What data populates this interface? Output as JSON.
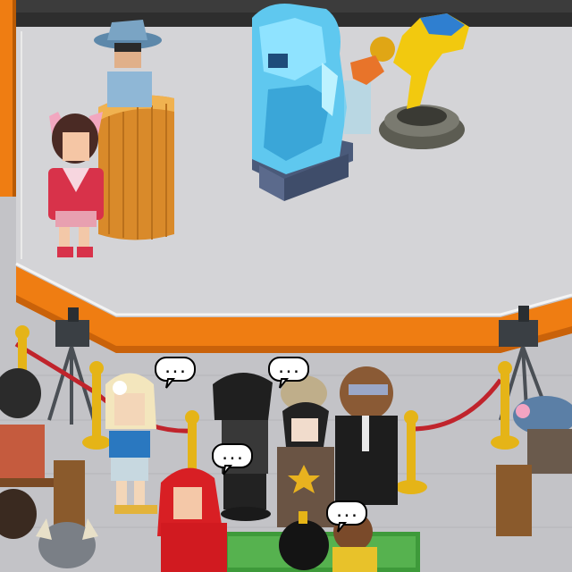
{
  "room": {
    "floor_color": "#c9c9cd",
    "stage_color": "#d3d3d6",
    "trim_color": "#ef7d12",
    "wall_color": "#2b2b2b"
  },
  "speech_bubbles": [
    {
      "text": "..."
    },
    {
      "text": "..."
    },
    {
      "text": "..."
    },
    {
      "text": "..."
    }
  ],
  "props": {
    "ice_statue": {
      "icon": "ice-warrior-statue"
    },
    "gold_statue": {
      "icon": "gold-figure-statue"
    },
    "podium": {
      "icon": "wooden-podium"
    },
    "cameras": {
      "icon": "video-camera-on-tripod"
    },
    "rope_barrier": {
      "icon": "velvet-rope-barrier"
    },
    "carpet": {
      "icon": "green-carpet"
    }
  }
}
